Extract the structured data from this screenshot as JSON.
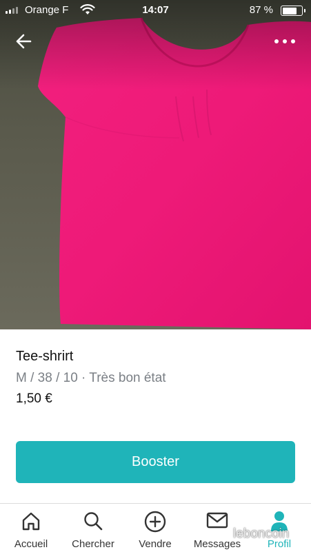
{
  "status_bar": {
    "carrier": "Orange F",
    "time": "14:07",
    "battery_percent": "87 %",
    "battery_level": 0.87
  },
  "header": {
    "back_icon": "arrow-left-icon",
    "more_icon": "more-horizontal-icon"
  },
  "listing": {
    "title": "Tee-shrirt",
    "details": "M / 38 / 10 · Très bon état",
    "price": "1,50 €"
  },
  "actions": {
    "booster_label": "Booster",
    "accent_color": "#1fb4b9"
  },
  "tabbar": {
    "tabs": [
      {
        "label": "Accueil",
        "icon": "home-icon"
      },
      {
        "label": "Chercher",
        "icon": "search-icon"
      },
      {
        "label": "Vendre",
        "icon": "plus-circle-icon"
      },
      {
        "label": "Messages",
        "icon": "mail-icon"
      },
      {
        "label": "Profil",
        "icon": "profile-icon",
        "active": true
      }
    ]
  },
  "watermark": "leboncoin"
}
